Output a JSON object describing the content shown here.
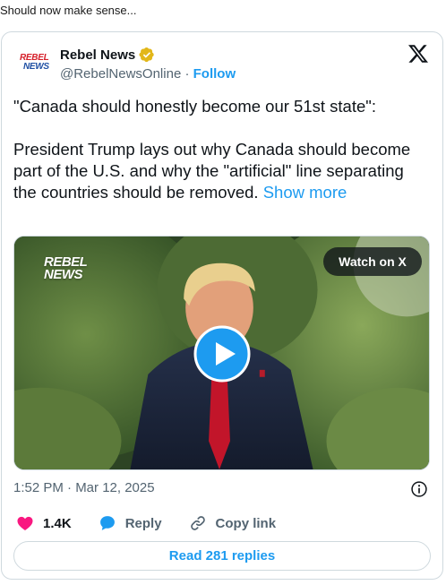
{
  "intro_text": "Should now make sense...",
  "author": {
    "logo_lines": [
      "REBEL",
      "NEWS"
    ],
    "name": "Rebel News",
    "handle": "@RebelNewsOnline",
    "separator": " · ",
    "follow_label": "Follow"
  },
  "tweet": {
    "quote": "\"Canada should honestly become our 51st state\":",
    "body": "President Trump lays out why Canada should become part of the U.S. and why the \"artificial\" line separating the countries should be removed.",
    "show_more": "Show more"
  },
  "media": {
    "watermark_lines": [
      "REBEL",
      "NEWS"
    ],
    "watch_label": "Watch on X",
    "play_icon": "play-icon"
  },
  "timestamp": "1:52 PM · Mar 12, 2025",
  "actions": {
    "like_count": "1.4K",
    "reply_label": "Reply",
    "copy_label": "Copy link"
  },
  "read_replies_label": "Read 281 replies",
  "colors": {
    "accent": "#1d9bf0",
    "like": "#f91880",
    "verified": "#e2b719",
    "muted": "#536471"
  }
}
